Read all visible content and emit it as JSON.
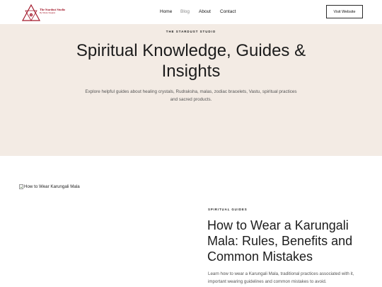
{
  "header": {
    "logo": {
      "title": "The Stardust Studio",
      "tagline": "By Nikita Shaghal"
    },
    "nav": [
      {
        "label": "Home",
        "active": false
      },
      {
        "label": "Blog",
        "active": true
      },
      {
        "label": "About",
        "active": false
      },
      {
        "label": "Contact",
        "active": false
      }
    ],
    "cta_label": "Visit Website"
  },
  "hero": {
    "eyebrow": "THE STARDUST STUDIO",
    "title": "Spiritual Knowledge, Guides & Insights",
    "description": "Explore helpful guides about healing crystals, Rudraksha, malas, zodiac bracelets, Vastu, spiritual practices and sacred products."
  },
  "post": {
    "image_alt": "How to Wear Karungali Mala",
    "category": "SPIRITUAL GUIDES",
    "title": "How to Wear a Karungali Mala: Rules, Benefits and Common Mistakes",
    "excerpt": "Learn how to wear a Karungali Mala, traditional practices associated with it, important wearing guidelines and common mistakes to avoid."
  },
  "colors": {
    "hero_bg": "#f3ebe4",
    "brand_red": "#a3192b",
    "text_dark": "#1c1c1c",
    "text_muted": "#555555"
  }
}
